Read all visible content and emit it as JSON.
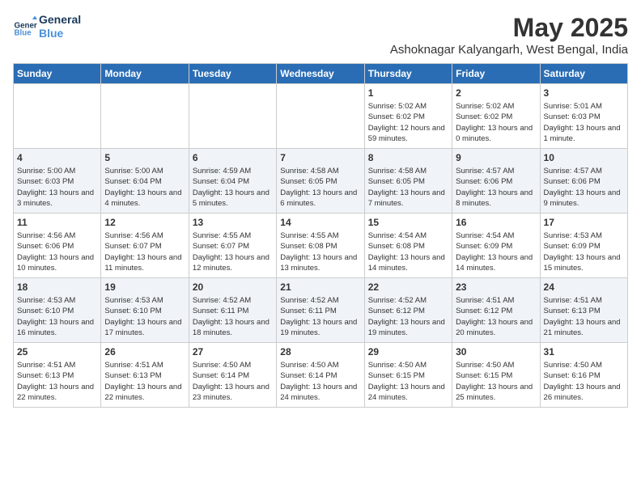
{
  "logo": {
    "line1": "General",
    "line2": "Blue"
  },
  "title": "May 2025",
  "location": "Ashoknagar Kalyangarh, West Bengal, India",
  "days_of_week": [
    "Sunday",
    "Monday",
    "Tuesday",
    "Wednesday",
    "Thursday",
    "Friday",
    "Saturday"
  ],
  "weeks": [
    [
      {
        "day": "",
        "info": ""
      },
      {
        "day": "",
        "info": ""
      },
      {
        "day": "",
        "info": ""
      },
      {
        "day": "",
        "info": ""
      },
      {
        "day": "1",
        "info": "Sunrise: 5:02 AM\nSunset: 6:02 PM\nDaylight: 12 hours and 59 minutes."
      },
      {
        "day": "2",
        "info": "Sunrise: 5:02 AM\nSunset: 6:02 PM\nDaylight: 13 hours and 0 minutes."
      },
      {
        "day": "3",
        "info": "Sunrise: 5:01 AM\nSunset: 6:03 PM\nDaylight: 13 hours and 1 minute."
      }
    ],
    [
      {
        "day": "4",
        "info": "Sunrise: 5:00 AM\nSunset: 6:03 PM\nDaylight: 13 hours and 3 minutes."
      },
      {
        "day": "5",
        "info": "Sunrise: 5:00 AM\nSunset: 6:04 PM\nDaylight: 13 hours and 4 minutes."
      },
      {
        "day": "6",
        "info": "Sunrise: 4:59 AM\nSunset: 6:04 PM\nDaylight: 13 hours and 5 minutes."
      },
      {
        "day": "7",
        "info": "Sunrise: 4:58 AM\nSunset: 6:05 PM\nDaylight: 13 hours and 6 minutes."
      },
      {
        "day": "8",
        "info": "Sunrise: 4:58 AM\nSunset: 6:05 PM\nDaylight: 13 hours and 7 minutes."
      },
      {
        "day": "9",
        "info": "Sunrise: 4:57 AM\nSunset: 6:06 PM\nDaylight: 13 hours and 8 minutes."
      },
      {
        "day": "10",
        "info": "Sunrise: 4:57 AM\nSunset: 6:06 PM\nDaylight: 13 hours and 9 minutes."
      }
    ],
    [
      {
        "day": "11",
        "info": "Sunrise: 4:56 AM\nSunset: 6:06 PM\nDaylight: 13 hours and 10 minutes."
      },
      {
        "day": "12",
        "info": "Sunrise: 4:56 AM\nSunset: 6:07 PM\nDaylight: 13 hours and 11 minutes."
      },
      {
        "day": "13",
        "info": "Sunrise: 4:55 AM\nSunset: 6:07 PM\nDaylight: 13 hours and 12 minutes."
      },
      {
        "day": "14",
        "info": "Sunrise: 4:55 AM\nSunset: 6:08 PM\nDaylight: 13 hours and 13 minutes."
      },
      {
        "day": "15",
        "info": "Sunrise: 4:54 AM\nSunset: 6:08 PM\nDaylight: 13 hours and 14 minutes."
      },
      {
        "day": "16",
        "info": "Sunrise: 4:54 AM\nSunset: 6:09 PM\nDaylight: 13 hours and 14 minutes."
      },
      {
        "day": "17",
        "info": "Sunrise: 4:53 AM\nSunset: 6:09 PM\nDaylight: 13 hours and 15 minutes."
      }
    ],
    [
      {
        "day": "18",
        "info": "Sunrise: 4:53 AM\nSunset: 6:10 PM\nDaylight: 13 hours and 16 minutes."
      },
      {
        "day": "19",
        "info": "Sunrise: 4:53 AM\nSunset: 6:10 PM\nDaylight: 13 hours and 17 minutes."
      },
      {
        "day": "20",
        "info": "Sunrise: 4:52 AM\nSunset: 6:11 PM\nDaylight: 13 hours and 18 minutes."
      },
      {
        "day": "21",
        "info": "Sunrise: 4:52 AM\nSunset: 6:11 PM\nDaylight: 13 hours and 19 minutes."
      },
      {
        "day": "22",
        "info": "Sunrise: 4:52 AM\nSunset: 6:12 PM\nDaylight: 13 hours and 19 minutes."
      },
      {
        "day": "23",
        "info": "Sunrise: 4:51 AM\nSunset: 6:12 PM\nDaylight: 13 hours and 20 minutes."
      },
      {
        "day": "24",
        "info": "Sunrise: 4:51 AM\nSunset: 6:13 PM\nDaylight: 13 hours and 21 minutes."
      }
    ],
    [
      {
        "day": "25",
        "info": "Sunrise: 4:51 AM\nSunset: 6:13 PM\nDaylight: 13 hours and 22 minutes."
      },
      {
        "day": "26",
        "info": "Sunrise: 4:51 AM\nSunset: 6:13 PM\nDaylight: 13 hours and 22 minutes."
      },
      {
        "day": "27",
        "info": "Sunrise: 4:50 AM\nSunset: 6:14 PM\nDaylight: 13 hours and 23 minutes."
      },
      {
        "day": "28",
        "info": "Sunrise: 4:50 AM\nSunset: 6:14 PM\nDaylight: 13 hours and 24 minutes."
      },
      {
        "day": "29",
        "info": "Sunrise: 4:50 AM\nSunset: 6:15 PM\nDaylight: 13 hours and 24 minutes."
      },
      {
        "day": "30",
        "info": "Sunrise: 4:50 AM\nSunset: 6:15 PM\nDaylight: 13 hours and 25 minutes."
      },
      {
        "day": "31",
        "info": "Sunrise: 4:50 AM\nSunset: 6:16 PM\nDaylight: 13 hours and 26 minutes."
      }
    ]
  ]
}
